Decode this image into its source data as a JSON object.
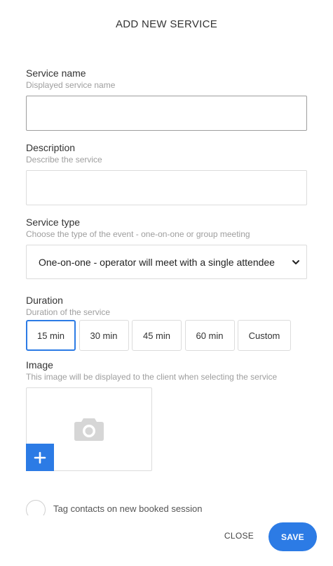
{
  "dialog": {
    "title": "ADD NEW SERVICE"
  },
  "service_name": {
    "label": "Service name",
    "hint": "Displayed service name",
    "value": ""
  },
  "description": {
    "label": "Description",
    "hint": "Describe the service",
    "value": ""
  },
  "service_type": {
    "label": "Service type",
    "hint": "Choose the type of the event - one-on-one or group meeting",
    "selected": "One-on-one - operator will meet with a single attendee"
  },
  "duration": {
    "label": "Duration",
    "hint": "Duration of the service",
    "options": [
      "15 min",
      "30 min",
      "45 min",
      "60 min",
      "Custom"
    ],
    "selected": "15 min"
  },
  "image": {
    "label": "Image",
    "hint": "This image will be displayed to the client when selecting the service",
    "placeholder_icon": "camera-icon",
    "add_icon": "plus-icon"
  },
  "tag_contacts": {
    "label": "Tag contacts on new booked session"
  },
  "footer": {
    "close_label": "CLOSE",
    "save_label": "SAVE"
  },
  "colors": {
    "accent": "#2c7be5",
    "hint_text": "#9e9e9e",
    "border": "#dcdcdc"
  }
}
